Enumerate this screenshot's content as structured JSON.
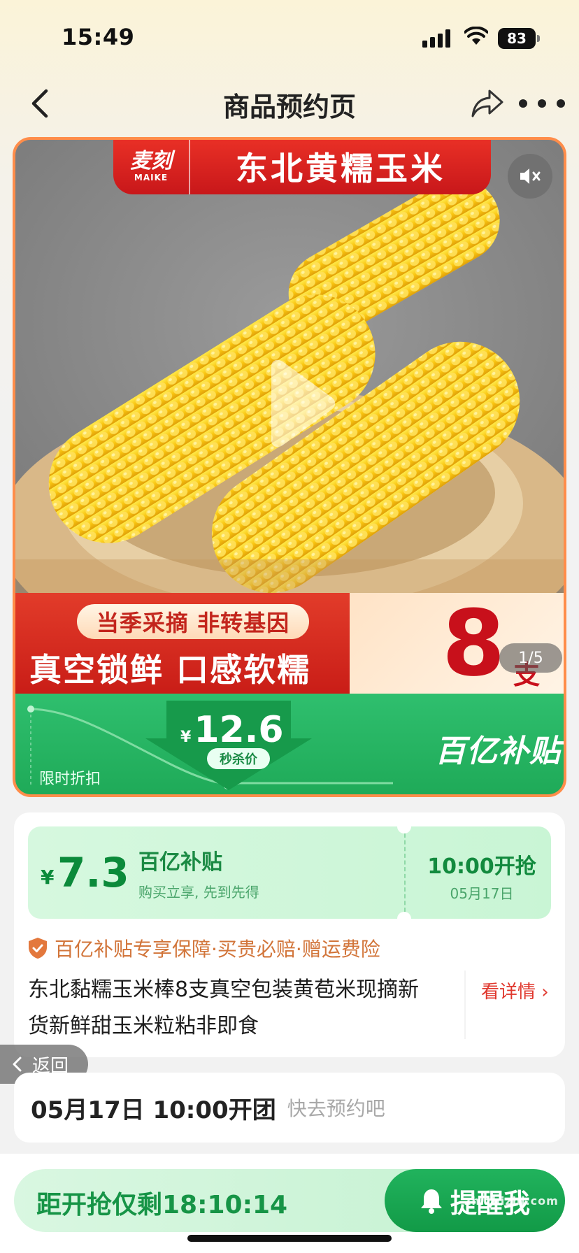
{
  "status_bar": {
    "time": "15:49",
    "battery": "83"
  },
  "nav": {
    "title": "商品预约页"
  },
  "media": {
    "brand_logo_cn": "麦刻",
    "brand_logo_en": "MAIKE",
    "brand_title": "东北黄糯玉米",
    "promo_tag": "当季采摘 非转基因",
    "promo_line": "真空锁鲜 口感软糯",
    "promo_count": "8",
    "promo_unit": "支",
    "page_indicator": "1/5"
  },
  "price_band": {
    "currency": "¥",
    "price": "12.6",
    "price_tag": "秒杀价",
    "limit_label": "限时折扣",
    "subsidy_logo": "百亿补贴"
  },
  "coupon": {
    "currency": "¥",
    "amount": "7.3",
    "title": "百亿补贴",
    "subtitle": "购买立享, 先到先得",
    "start_time": "10:00开抢",
    "start_date": "05月17日"
  },
  "guarantee": {
    "text": "百亿补贴专享保障·买贵必赔·赠运费险"
  },
  "product": {
    "title": "东北黏糯玉米棒8支真空包装黄苞米现摘新货新鲜甜玉米粒粘非即食",
    "detail_link": "看详情 ›"
  },
  "return_pill": {
    "label": "返回"
  },
  "group": {
    "date_time": "05月17日  10:00开团",
    "hint": "快去预约吧"
  },
  "bottom": {
    "countdown": "距开抢仅剩18:10:14",
    "remind_label": "提醒我",
    "watermark": "zhizhizhi.com"
  },
  "colors": {
    "accent_green": "#1ea957",
    "accent_red": "#c8171a",
    "card_border": "#ff8d4a"
  }
}
